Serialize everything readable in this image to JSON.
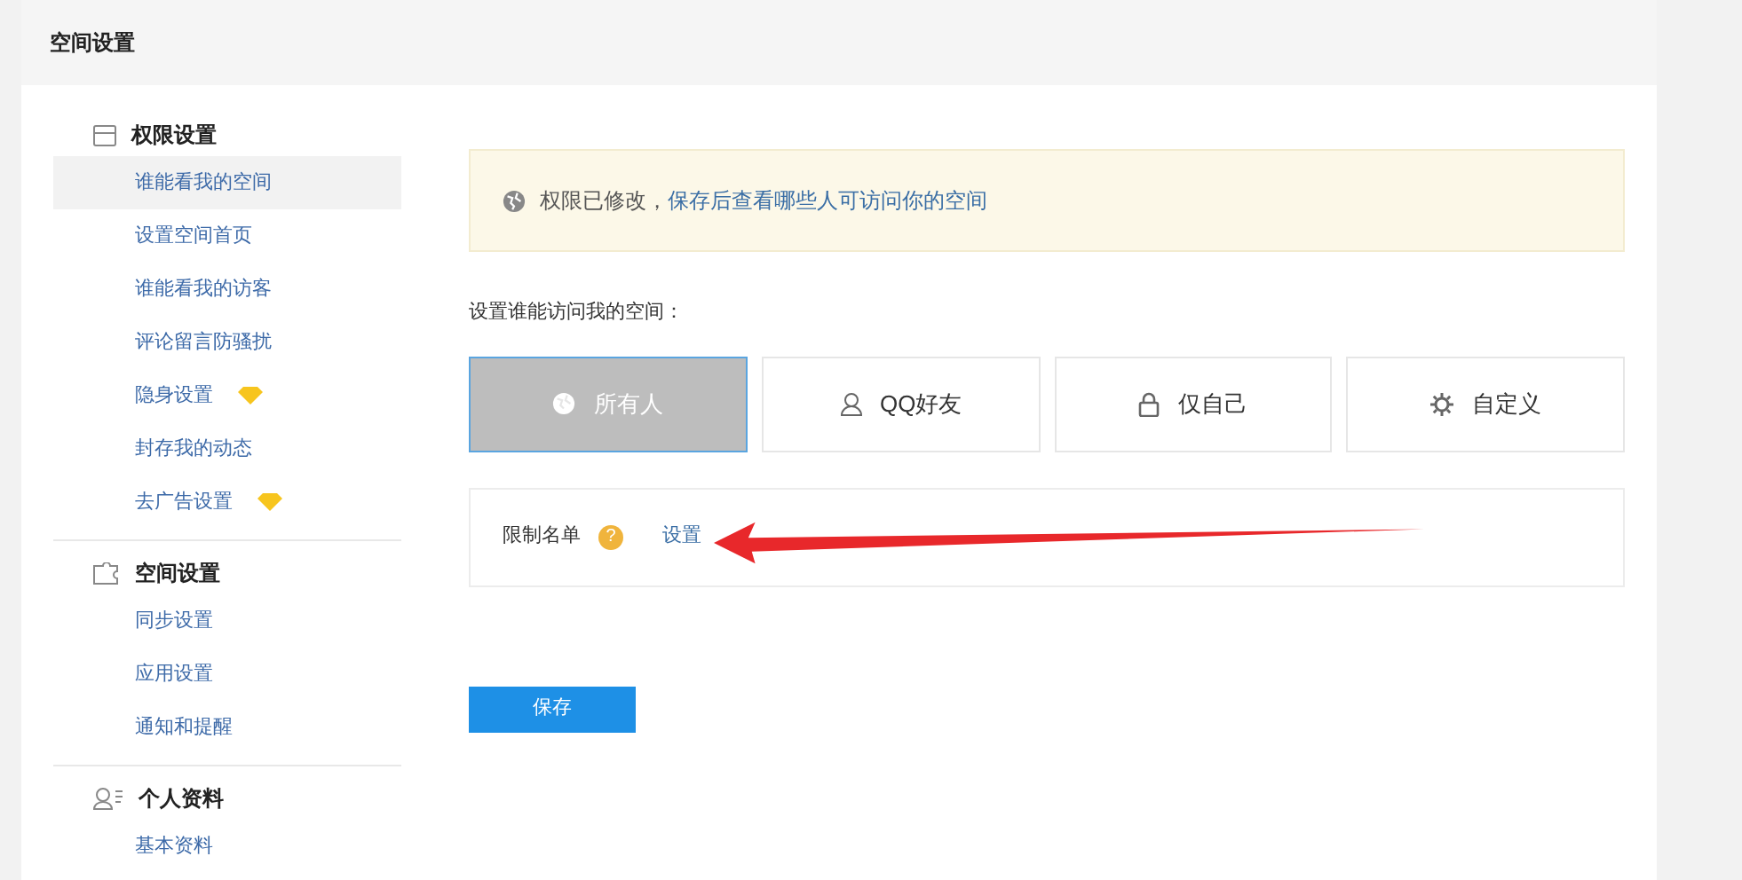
{
  "header": {
    "title": "空间设置"
  },
  "sidebar": {
    "groups": [
      {
        "kind": "lock",
        "title": "权限设置",
        "items": [
          {
            "label": "谁能看我的空间",
            "selected": true,
            "vip": false
          },
          {
            "label": "设置空间首页",
            "selected": false,
            "vip": false
          },
          {
            "label": "谁能看我的访客",
            "selected": false,
            "vip": false
          },
          {
            "label": "评论留言防骚扰",
            "selected": false,
            "vip": false
          },
          {
            "label": "隐身设置",
            "selected": false,
            "vip": true
          },
          {
            "label": "封存我的动态",
            "selected": false,
            "vip": false
          },
          {
            "label": "去广告设置",
            "selected": false,
            "vip": true
          }
        ]
      },
      {
        "kind": "puzzle",
        "title": "空间设置",
        "items": [
          {
            "label": "同步设置",
            "selected": false,
            "vip": false
          },
          {
            "label": "应用设置",
            "selected": false,
            "vip": false
          },
          {
            "label": "通知和提醒",
            "selected": false,
            "vip": false
          }
        ]
      },
      {
        "kind": "profile",
        "title": "个人资料",
        "items": [
          {
            "label": "基本资料",
            "selected": false,
            "vip": false
          }
        ]
      }
    ]
  },
  "notice": {
    "text": "权限已修改，",
    "link": "保存后查看哪些人可访问你的空间"
  },
  "access": {
    "label": "设置谁能访问我的空间：",
    "options": [
      {
        "kind": "globe",
        "label": "所有人",
        "selected": true
      },
      {
        "kind": "person",
        "label": "QQ好友",
        "selected": false
      },
      {
        "kind": "lock",
        "label": "仅自己",
        "selected": false
      },
      {
        "kind": "gear",
        "label": "自定义",
        "selected": false
      }
    ]
  },
  "blocklist": {
    "label": "限制名单",
    "help": "?",
    "link": "设置"
  },
  "save_button": "保存"
}
